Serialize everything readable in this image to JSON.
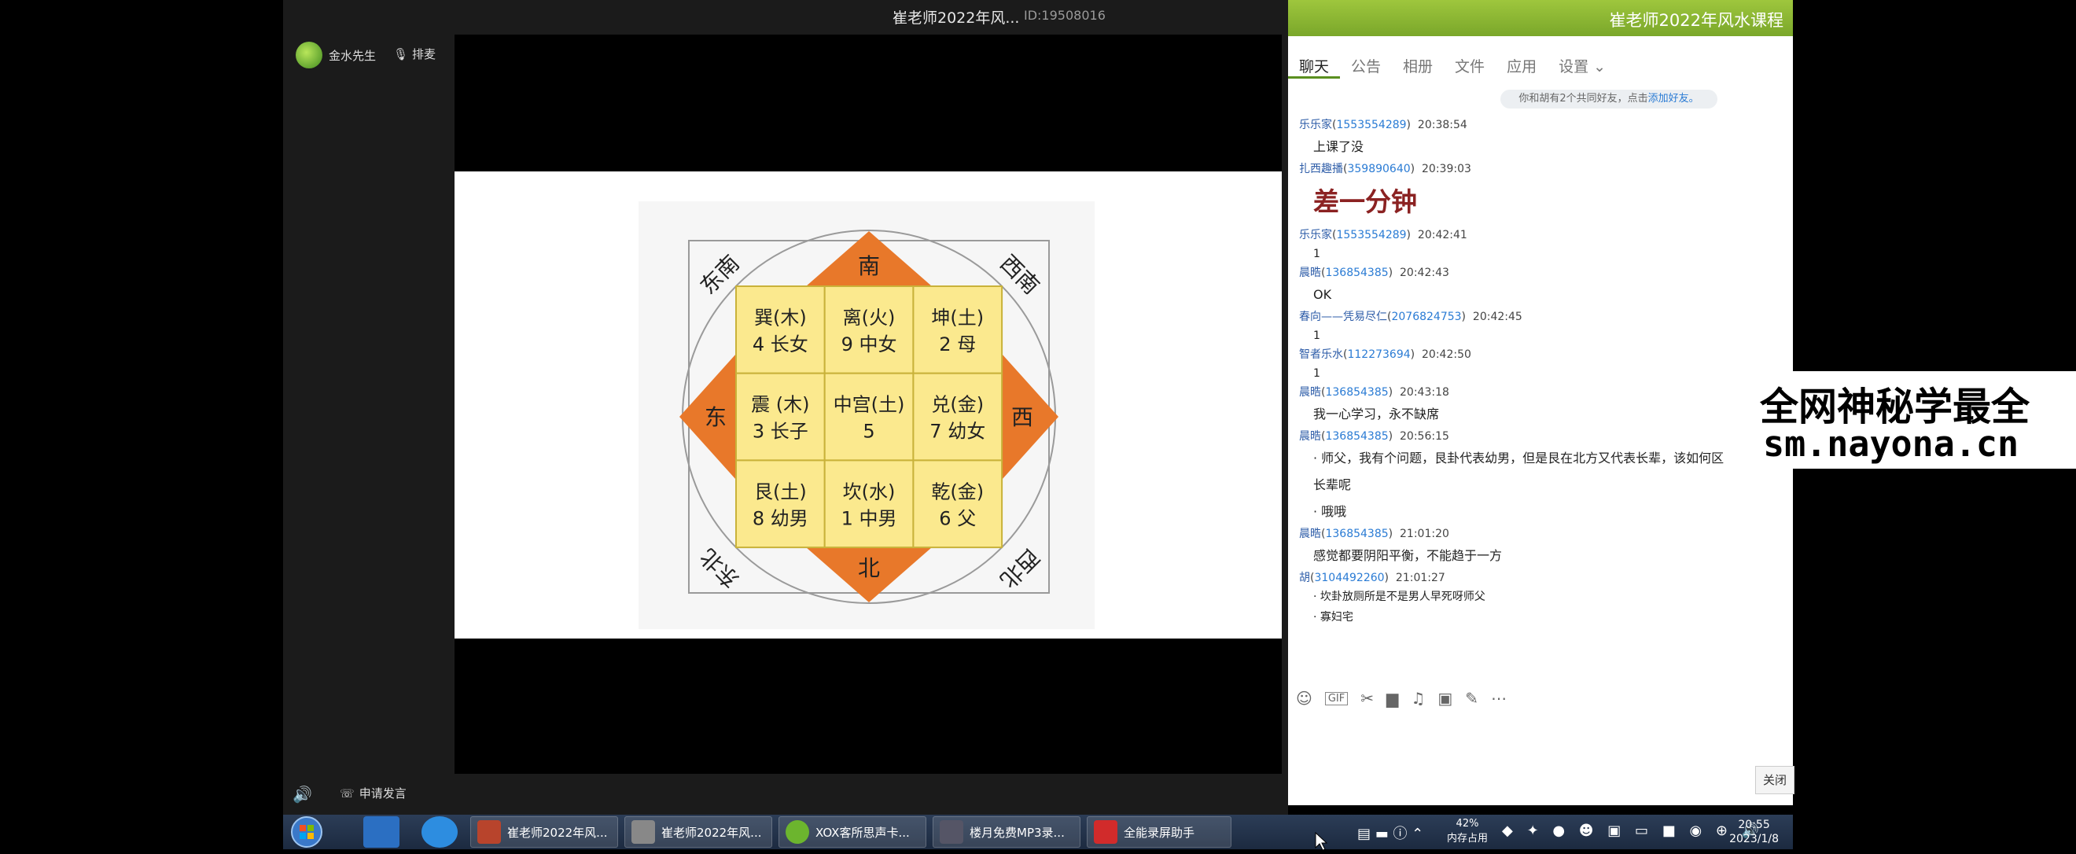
{
  "window": {
    "title": "崔老师2022年风...",
    "room_id": "ID:19508016"
  },
  "sidebar": {
    "user_name": "金水先生",
    "queue_button": "排麦"
  },
  "bottombar": {
    "apply_speak": "申请发言"
  },
  "diagram": {
    "directions": {
      "south": "南",
      "north": "北",
      "east": "东",
      "west": "西",
      "southeast": "东南",
      "southwest": "西南",
      "northeast": "东北",
      "northwest": "西北"
    },
    "cells": [
      {
        "l1": "巽(木)",
        "l2": "4 长女"
      },
      {
        "l1": "离(火)",
        "l2": "9 中女"
      },
      {
        "l1": "坤(土)",
        "l2": "2 母"
      },
      {
        "l1": "震 (木)",
        "l2": "3 长子"
      },
      {
        "l1": "中宫(土)",
        "l2": "5"
      },
      {
        "l1": "兑(金)",
        "l2": "7 幼女"
      },
      {
        "l1": "艮(土)",
        "l2": "8 幼男"
      },
      {
        "l1": "坎(水)",
        "l2": "1 中男"
      },
      {
        "l1": "乾(金)",
        "l2": "6 父"
      }
    ]
  },
  "chat": {
    "header_title": "崔老师2022年风水课程",
    "tabs": [
      "聊天",
      "公告",
      "相册",
      "文件",
      "应用",
      "设置 ⌄"
    ],
    "notice_text": "你和胡有2个共同好友，点击",
    "notice_link": "添加好友。",
    "messages": [
      {
        "user": "乐乐家",
        "qq": "1553554289",
        "time": "20:38:54",
        "text": "上课了没",
        "style": "normal"
      },
      {
        "user": "扎西趣播",
        "qq": "359890640",
        "time": "20:39:03",
        "text": "差一分钟",
        "style": "big"
      },
      {
        "user": "乐乐家",
        "qq": "1553554289",
        "time": "20:42:41",
        "text": "1",
        "style": "small"
      },
      {
        "user": "晨晧",
        "qq": "136854385",
        "time": "20:42:43",
        "text": "OK",
        "style": "normal"
      },
      {
        "user": "春向——凭易尽仁",
        "qq": "2076824753",
        "time": "20:42:45",
        "text": "1",
        "style": "small"
      },
      {
        "user": "智者乐水",
        "qq": "112273694",
        "time": "20:42:50",
        "text": "1",
        "style": "small"
      },
      {
        "user": "晨晧",
        "qq": "136854385",
        "time": "20:43:18",
        "text": "我一心学习，永不缺席",
        "style": "normal"
      },
      {
        "user": "晨晧",
        "qq": "136854385",
        "time": "20:56:15",
        "text": "· 师父，我有个问题，艮卦代表幼男，但是艮在北方又代表长辈，该如何区",
        "text2": "长辈呢",
        "text3": "· 哦哦",
        "style": "normal"
      },
      {
        "user": "晨晧",
        "qq": "136854385",
        "time": "21:01:20",
        "text": "感觉都要阴阳平衡，不能趋于一方",
        "style": "normal"
      },
      {
        "user": "胡",
        "qq": "3104492260",
        "time": "21:01:27",
        "text": "· 坎卦放厕所是不是男人早死呀师父",
        "text2": "· 寡妇宅",
        "style": "small"
      }
    ],
    "close_button": "关闭"
  },
  "watermark": {
    "line1": "全网神秘学最全",
    "line2": "sm.nayona.cn"
  },
  "taskbar": {
    "tasks": [
      "崔老师2022年风...",
      "崔老师2022年风...",
      "XOX客所思声卡...",
      "楼月免费MP3录...",
      "全能录屏助手"
    ],
    "memory_percent": "42%",
    "memory_label": "内存占用",
    "time": "20:55",
    "date": "2023/1/8"
  },
  "colors": {
    "accent_green": "#7aa72a",
    "diamond_orange": "#e8782a",
    "cell_yellow": "#fbe98e"
  }
}
